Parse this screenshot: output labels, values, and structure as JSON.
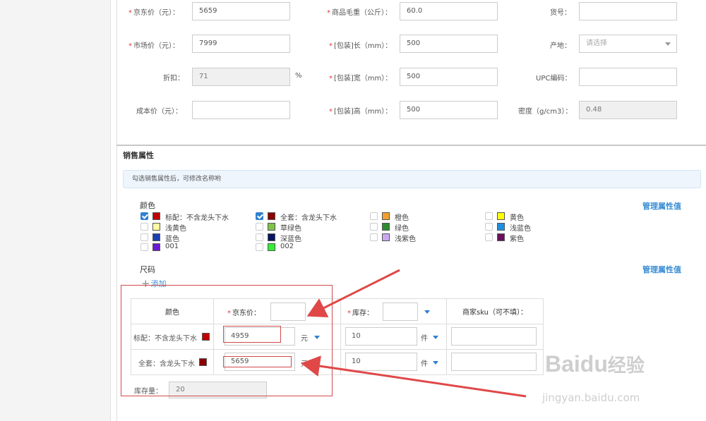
{
  "top_form": {
    "jd_price_label": "京东价（元）：",
    "jd_price_value": "5659",
    "weight_label": "商品毛重（公斤）：",
    "weight_value": "60.0",
    "item_no_label": "货号：",
    "item_no_value": "",
    "market_price_label": "市场价（元）：",
    "market_price_value": "7999",
    "pkg_length_label": "[包装]长（mm）：",
    "pkg_length_value": "500",
    "origin_label": "产地：",
    "origin_placeholder": "请选择",
    "discount_label": "折扣：",
    "discount_value": "71",
    "discount_unit": "%",
    "pkg_width_label": "[包装]宽（mm）：",
    "pkg_width_value": "500",
    "upc_label": "UPC编码：",
    "upc_value": "",
    "cost_label": "成本价（元）：",
    "cost_value": "",
    "pkg_height_label": "[包装]高（mm）：",
    "pkg_height_value": "500",
    "density_label": "密度（g/cm3）：",
    "density_value": "0.48"
  },
  "sales_attrs": {
    "title": "销售属性",
    "tip": "勾选销售属性后，可修改名称哟",
    "color_group_title": "颜色",
    "manage_label": "管理属性值",
    "colors": [
      {
        "label": "标配：不含龙头下水",
        "checked": true,
        "color": "#c00000"
      },
      {
        "label": "全套：含龙头下水",
        "checked": true,
        "color": "#8b0000"
      },
      {
        "label": "橙色",
        "checked": false,
        "color": "#f0a030"
      },
      {
        "label": "黄色",
        "checked": false,
        "color": "#ffff00"
      },
      {
        "label": "浅黄色",
        "checked": false,
        "color": "#ffffa0"
      },
      {
        "label": "草绿色",
        "checked": false,
        "color": "#7dc34a"
      },
      {
        "label": "绿色",
        "checked": false,
        "color": "#2e8b2e"
      },
      {
        "label": "浅蓝色",
        "checked": false,
        "color": "#1e90e0"
      },
      {
        "label": "蓝色",
        "checked": false,
        "color": "#1a3fb0"
      },
      {
        "label": "深蓝色",
        "checked": false,
        "color": "#0a1560"
      },
      {
        "label": "浅紫色",
        "checked": false,
        "color": "#c9a8f0"
      },
      {
        "label": "紫色",
        "checked": false,
        "color": "#6a1060"
      },
      {
        "label": "001",
        "checked": false,
        "color": "#6a1ad0"
      },
      {
        "label": "002",
        "checked": false,
        "color": "#33ee33"
      }
    ],
    "size_group_title": "尺码",
    "add_label": "添加"
  },
  "sku_table": {
    "col_color": "颜色",
    "col_price": "京东价：",
    "col_stock": "库存：",
    "col_sku": "商家sku（可不填）：",
    "rows": [
      {
        "color_name": "标配：不含龙头下水",
        "swatch": "#c00000",
        "price": "4959",
        "price_unit": "元",
        "stock": "10",
        "stock_unit": "件",
        "sku": ""
      },
      {
        "color_name": "全套：含龙头下水",
        "swatch": "#8b0000",
        "price": "5659",
        "price_unit": "元",
        "stock": "10",
        "stock_unit": "件",
        "sku": ""
      }
    ],
    "stock_total_label": "库存量：",
    "stock_total_value": "20"
  },
  "watermark": {
    "brand": "Baidu",
    "cn": "经验",
    "url": "jingyan.baidu.com"
  },
  "colors": {
    "required": "#e4393c",
    "link": "#3a8dd3",
    "annotation": "#d04a4a"
  }
}
